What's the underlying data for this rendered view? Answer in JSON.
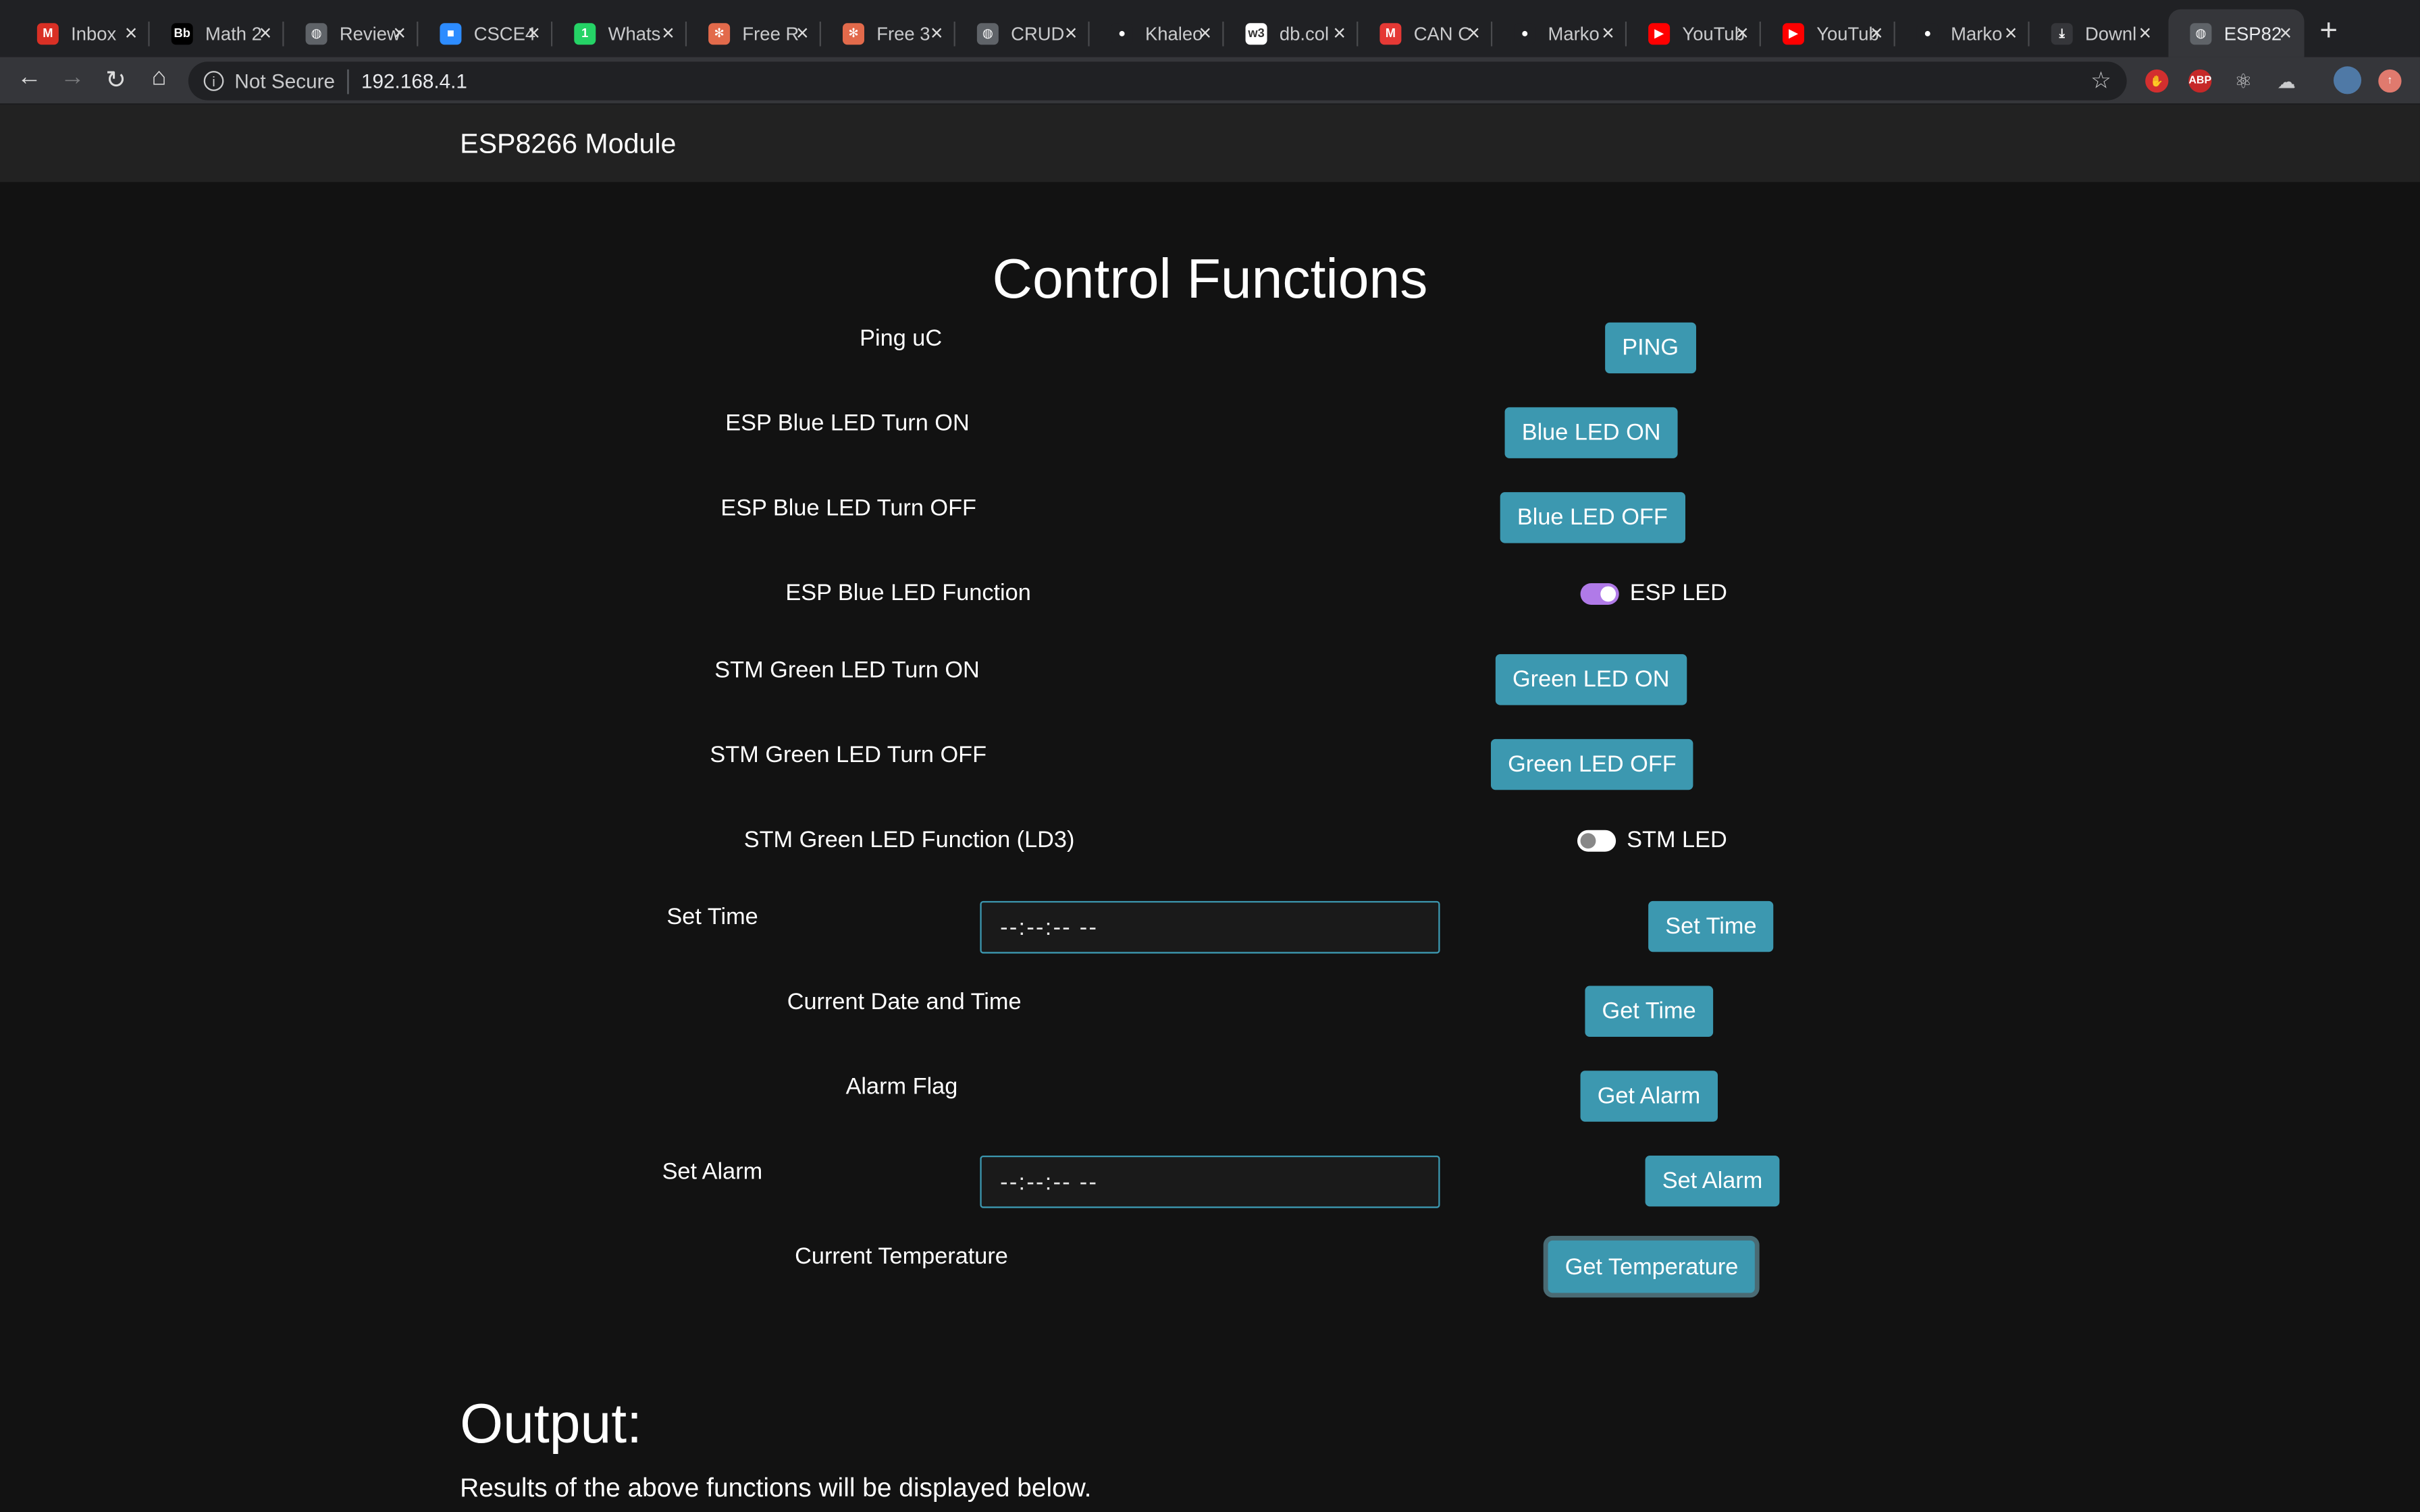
{
  "browser": {
    "tabs": [
      {
        "title": "Inbox",
        "icon": "gmail-icon",
        "color": "#d93025",
        "glyph": "M"
      },
      {
        "title": "Math 2",
        "icon": "blackboard-icon",
        "color": "#000000",
        "glyph": "Bb"
      },
      {
        "title": "Review",
        "icon": "globe-icon",
        "color": "#5f6368",
        "glyph": "◍"
      },
      {
        "title": "CSCE4",
        "icon": "zoom-icon",
        "color": "#2d8cff",
        "glyph": "■"
      },
      {
        "title": "Whats",
        "icon": "whatsapp-icon",
        "color": "#25d366",
        "glyph": "1"
      },
      {
        "title": "Free R",
        "icon": "pinwheel-icon",
        "color": "#e26a4b",
        "glyph": "✻"
      },
      {
        "title": "Free 3",
        "icon": "pinwheel-icon",
        "color": "#e26a4b",
        "glyph": "✻"
      },
      {
        "title": "CRUD",
        "icon": "globe-icon",
        "color": "#5f6368",
        "glyph": "◍"
      },
      {
        "title": "Khaleo",
        "icon": "github-icon",
        "color": "#202124",
        "glyph": "●"
      },
      {
        "title": "db.col",
        "icon": "w3schools-icon",
        "color": "#ffffff",
        "glyph": "w3"
      },
      {
        "title": "CAN C",
        "icon": "microchip-icon",
        "color": "#e53935",
        "glyph": "M"
      },
      {
        "title": "Marko",
        "icon": "github-icon",
        "color": "#202124",
        "glyph": "●"
      },
      {
        "title": "YouTub",
        "icon": "youtube-icon",
        "color": "#ff0000",
        "glyph": "▶"
      },
      {
        "title": "YouTub",
        "icon": "youtube-icon",
        "color": "#ff0000",
        "glyph": "▶"
      },
      {
        "title": "Marko",
        "icon": "github-icon",
        "color": "#202124",
        "glyph": "●"
      },
      {
        "title": "Downl",
        "icon": "download-icon",
        "color": "#35363a",
        "glyph": "⤓"
      },
      {
        "title": "ESP82",
        "icon": "globe-icon",
        "color": "#5f6368",
        "glyph": "◍"
      }
    ],
    "security_label": "Not Secure",
    "url": "192.168.4.1"
  },
  "navbar": {
    "brand": "ESP8266 Module"
  },
  "main": {
    "title": "Control Functions",
    "rows": {
      "ping": {
        "label": "Ping uC",
        "button": "PING"
      },
      "blue_on": {
        "label": "ESP Blue LED Turn ON",
        "button": "Blue LED ON"
      },
      "blue_off": {
        "label": "ESP Blue LED Turn OFF",
        "button": "Blue LED OFF"
      },
      "blue_fn": {
        "label": "ESP Blue LED Function",
        "toggle_label": "ESP LED",
        "toggle_on": true
      },
      "green_on": {
        "label": "STM Green LED Turn ON",
        "button": "Green LED ON"
      },
      "green_off": {
        "label": "STM Green LED Turn OFF",
        "button": "Green LED OFF"
      },
      "green_fn": {
        "label": "STM Green LED Function (LD3)",
        "toggle_label": "STM LED",
        "toggle_on": false
      },
      "set_time": {
        "label": "Set Time",
        "input_value": "--:--:-- --",
        "button": "Set Time"
      },
      "get_time": {
        "label": "Current Date and Time",
        "button": "Get Time"
      },
      "alarm_flag": {
        "label": "Alarm Flag",
        "button": "Get Alarm"
      },
      "set_alarm": {
        "label": "Set Alarm",
        "input_value": "--:--:-- --",
        "button": "Set Alarm"
      },
      "temperature": {
        "label": "Current Temperature",
        "button": "Get Temperature"
      }
    }
  },
  "output": {
    "heading": "Output:",
    "description": "Results of the above functions will be displayed below."
  },
  "colors": {
    "button": "#3c98b0",
    "toggle_on": "#b07ae8",
    "background": "#121212",
    "navbar": "#222222"
  }
}
